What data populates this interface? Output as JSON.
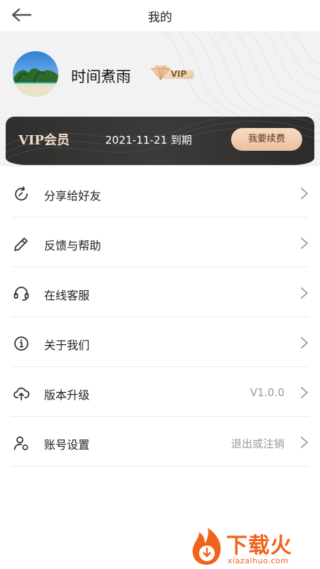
{
  "header": {
    "title": "我的"
  },
  "profile": {
    "username": "时间煮雨",
    "vip_badge": "VIP"
  },
  "vip_card": {
    "title": "VIP会员",
    "expire": "2021-11-21 到期",
    "renew_label": "我要续费"
  },
  "menu": [
    {
      "label": "分享给好友",
      "value": "",
      "icon": "share-icon"
    },
    {
      "label": "反馈与帮助",
      "value": "",
      "icon": "pencil-icon"
    },
    {
      "label": "在线客服",
      "value": "",
      "icon": "headset-icon"
    },
    {
      "label": "关于我们",
      "value": "",
      "icon": "info-icon"
    },
    {
      "label": "版本升级",
      "value": "V1.0.0",
      "icon": "cloud-upload-icon"
    },
    {
      "label": "账号设置",
      "value": "退出或注销",
      "icon": "user-settings-icon"
    }
  ],
  "watermark": {
    "text": "下载火",
    "sub": "xiazaihuo.com"
  },
  "colors": {
    "accent_gold": "#f3dcc4",
    "vip_card_bg": "#2f2f2f",
    "watermark": "#f0631c"
  }
}
